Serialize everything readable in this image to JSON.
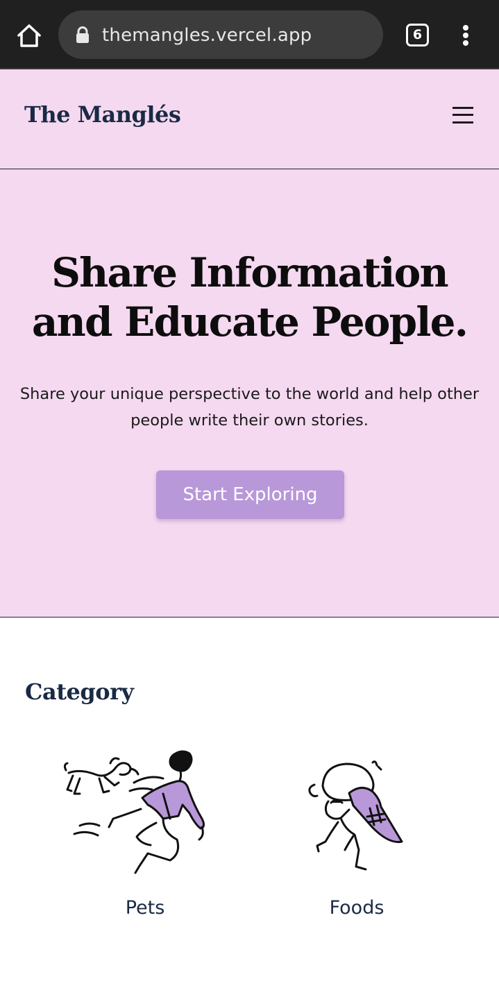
{
  "browser": {
    "url": "themangles.vercel.app",
    "tab_count": "6"
  },
  "header": {
    "logo": "The Manglés"
  },
  "hero": {
    "title_line1": "Share Information",
    "title_line2": "and Educate People.",
    "subtitle_line1": "Share your unique perspective to the world and help other",
    "subtitle_line2": "people write their own stories.",
    "cta_label": "Start Exploring"
  },
  "category": {
    "title": "Category",
    "items": [
      {
        "label": "Pets",
        "icon": "pets-illustration"
      },
      {
        "label": "Foods",
        "icon": "foods-illustration"
      }
    ]
  },
  "colors": {
    "browser_bar": "#202020",
    "url_pill": "#3c3c3c",
    "header_bg": "#f5d9f0",
    "brand_navy": "#1a2a44",
    "accent_purple": "#b898d8"
  }
}
